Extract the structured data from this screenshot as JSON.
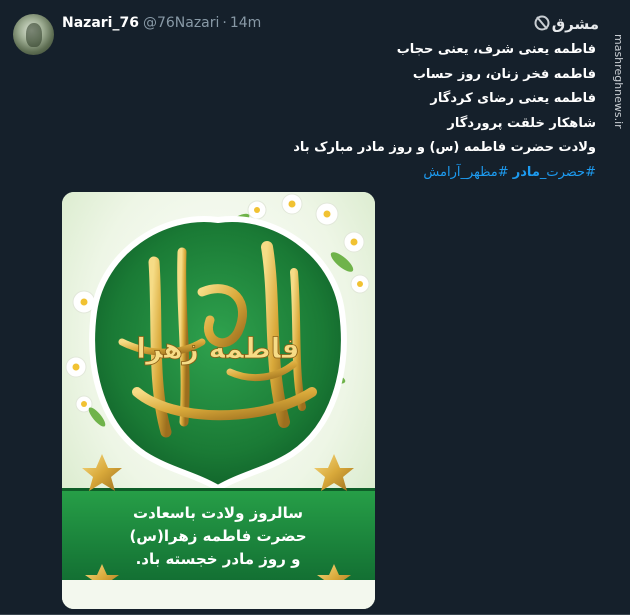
{
  "tweet": {
    "display_name": "Nazari_76",
    "handle": "@76Nazari",
    "separator": "·",
    "time": "14m",
    "lines": [
      "فاطمه یعنی شرف، یعنی حجاب",
      "فاطمه فخر زنان، روز حساب",
      "فاطمه یعنی رضای کردگار",
      "شاهکار خلقت پروردگار"
    ],
    "last_line_part1": "ولادت حضرت فاطمه (س) و روز ",
    "last_line_bold": "مادر",
    "last_line_part2": " مبارک باد",
    "hashtag1_part1": "#حضرت_",
    "hashtag1_bold": "مادر",
    "hashtag2": " #مظهر_آرامش"
  },
  "watermark": {
    "logo_text": "مشرق",
    "url": "mashreghnews.ir"
  },
  "image": {
    "calligraphy": "فاطمه زهرا",
    "banner_lines": [
      "سالروز ولادت باسعادت",
      "حضرت فاطمه زهرا(س)",
      "و روز مادر خجسته باد."
    ],
    "colors": {
      "green": "#1f8a3d",
      "dark_green": "#0f5e28",
      "gold": "#d9b24a",
      "cream": "#f3f8ee"
    }
  }
}
